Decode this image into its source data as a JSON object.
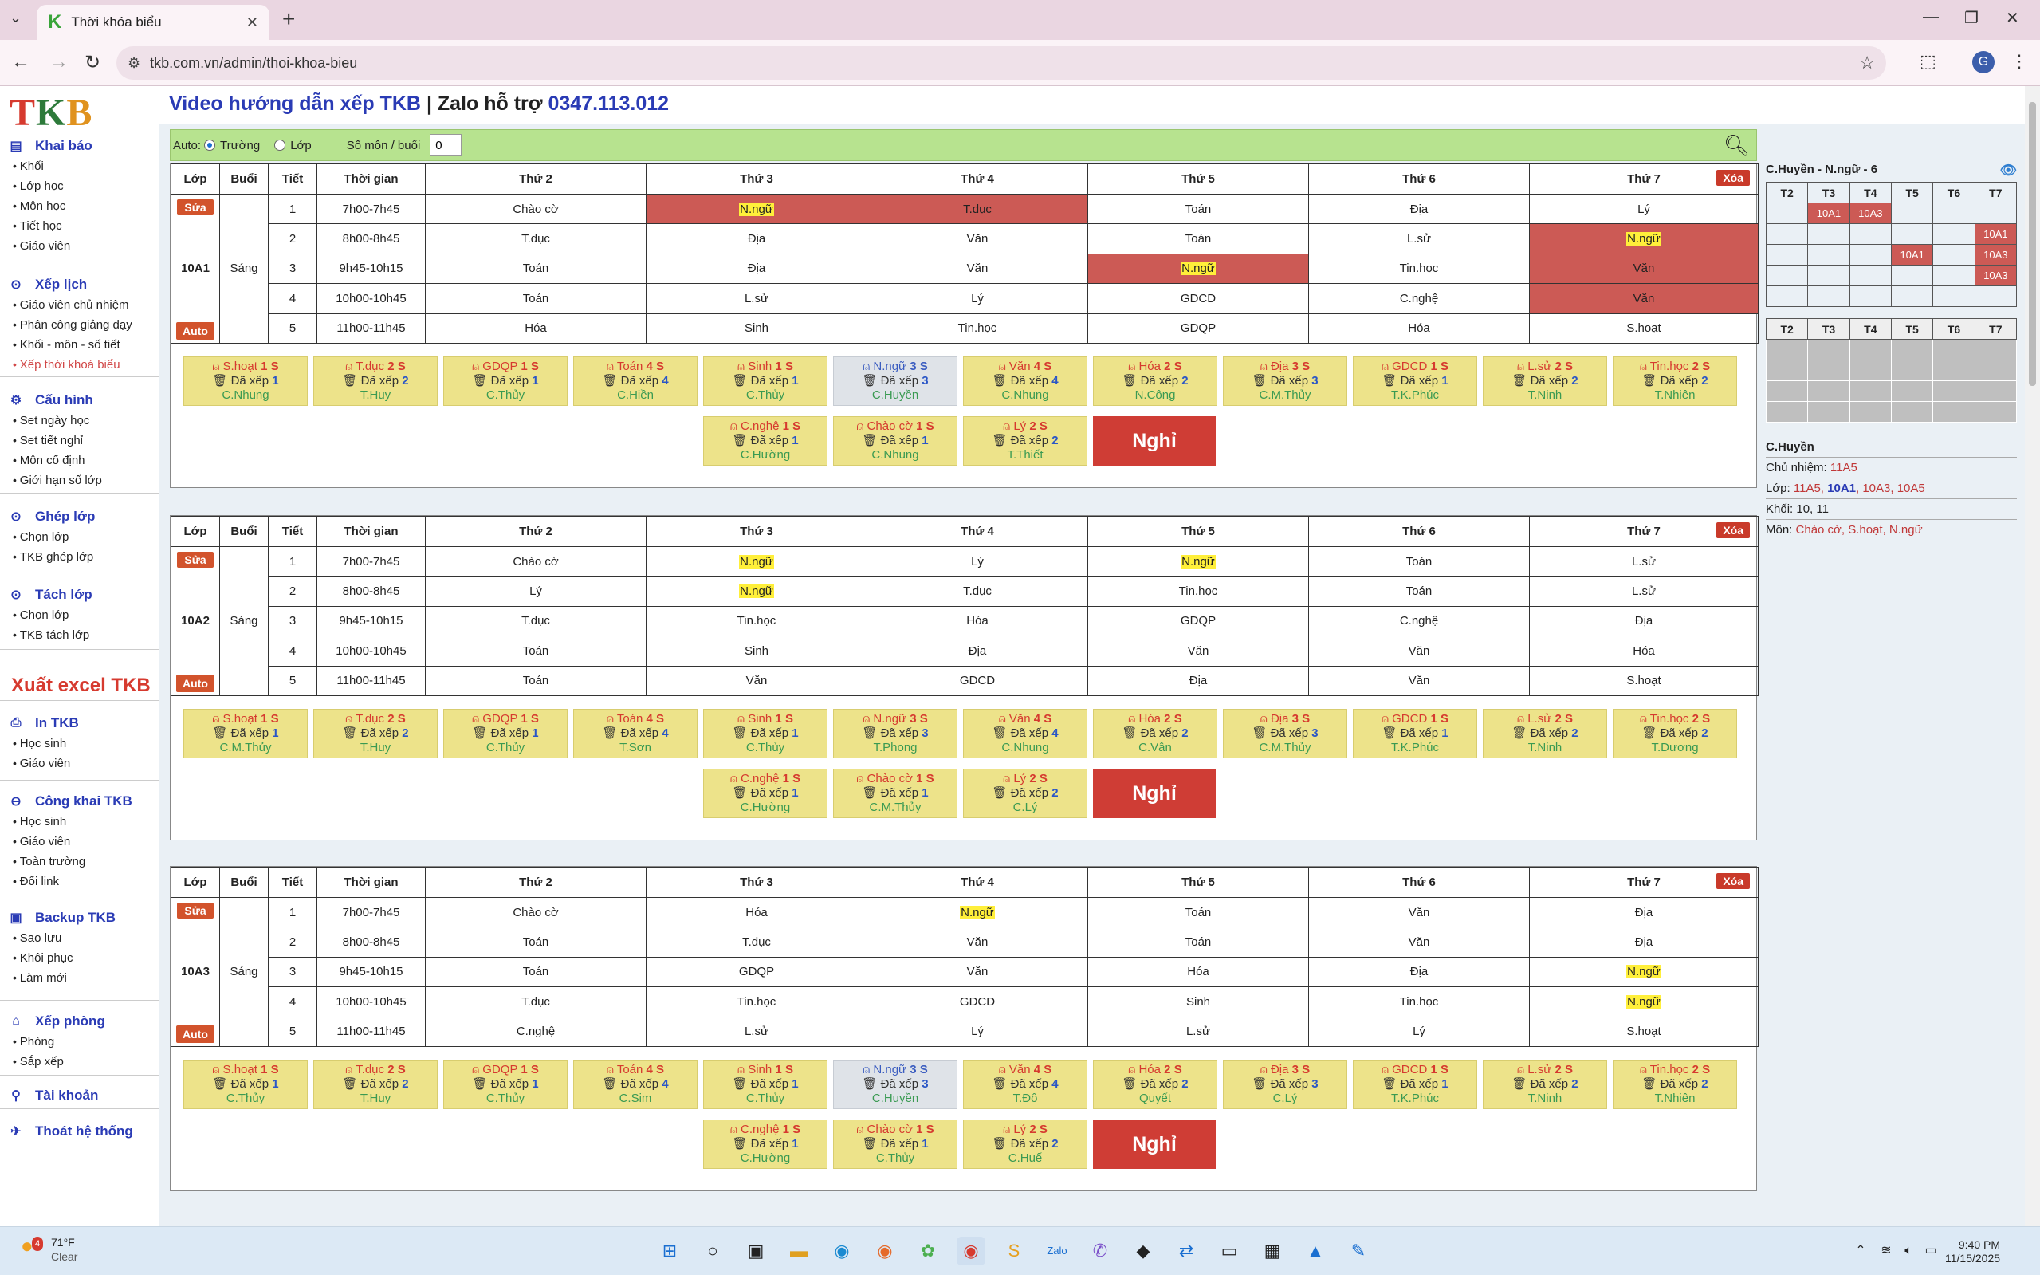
{
  "browser": {
    "tab_title": "Thời khóa biểu",
    "url": "tkb.com.vn/admin/thoi-khoa-bieu",
    "profile_initial": "G"
  },
  "sidebar": {
    "logo": {
      "part1": "T",
      "part2": "K",
      "part3": "B"
    },
    "groups": [
      {
        "title": "Khai báo",
        "icon": "folder-icon",
        "items": [
          "Khối",
          "Lớp học",
          "Môn học",
          "Tiết học",
          "Giáo viên"
        ]
      },
      {
        "title": "Xếp lịch",
        "icon": "check-circle-icon",
        "items": [
          "Giáo viên chủ nhiệm",
          "Phân công giảng dạy",
          "Khối - môn - số tiết",
          "Xếp thời khoá biểu"
        ]
      },
      {
        "title": "Cấu hình",
        "icon": "gear-icon",
        "items": [
          "Set ngày học",
          "Set tiết nghỉ",
          "Môn cố định",
          "Giới hạn số lớp"
        ]
      },
      {
        "title": "Ghép lớp",
        "icon": "check-circle-icon",
        "items": [
          "Chọn lớp",
          "TKB ghép lớp"
        ]
      },
      {
        "title": "Tách lớp",
        "icon": "check-circle-icon",
        "items": [
          "Chọn lớp",
          "TKB tách lớp"
        ]
      },
      {
        "title": "In TKB",
        "icon": "printer-icon",
        "items": [
          "Học sinh",
          "Giáo viên"
        ]
      },
      {
        "title": "Công khai TKB",
        "icon": "link-icon",
        "items": [
          "Học sinh",
          "Giáo viên",
          "Toàn trường",
          "Đổi link"
        ]
      },
      {
        "title": "Backup TKB",
        "icon": "save-icon",
        "items": [
          "Sao lưu",
          "Khôi phục",
          "Làm mới"
        ]
      },
      {
        "title": "Xếp phòng",
        "icon": "building-icon",
        "items": [
          "Phòng",
          "Sắp xếp"
        ]
      },
      {
        "title": "Tài khoản",
        "icon": "user-icon",
        "items": []
      },
      {
        "title": "Thoát hệ thống",
        "icon": "running-icon",
        "items": []
      }
    ],
    "active_item": "Xếp thời khoá biểu",
    "export_label": "Xuất excel TKB"
  },
  "header": {
    "video": "Video hướng dẫn xếp TKB",
    "sep": " | Zalo hỗ trợ ",
    "phone": "0347.113.012"
  },
  "filter": {
    "auto_label": "Auto:",
    "opt1": "Trường",
    "opt2": "Lớp",
    "count_label": "Số môn / buổi",
    "count_value": "0"
  },
  "table_headers": [
    "Lớp",
    "Buổi",
    "Tiết",
    "Thời gian",
    "Thứ 2",
    "Thứ 3",
    "Thứ 4",
    "Thứ 5",
    "Thứ 6",
    "Thứ 7"
  ],
  "buttons": {
    "edit": "Sửa",
    "auto": "Auto",
    "delete": "Xóa",
    "off": "Nghỉ"
  },
  "card_labels": {
    "arranged": "Đã xếp"
  },
  "session": "Sáng",
  "periods": [
    {
      "n": "1",
      "time": "7h00-7h45"
    },
    {
      "n": "2",
      "time": "8h00-8h45"
    },
    {
      "n": "3",
      "time": "9h45-10h15"
    },
    {
      "n": "4",
      "time": "10h00-10h45"
    },
    {
      "n": "5",
      "time": "11h00-11h45"
    }
  ],
  "classes": [
    {
      "name": "10A1",
      "rows": [
        [
          {
            "s": "Chào cờ"
          },
          {
            "s": "N.ngữ",
            "hl": true,
            "red": true
          },
          {
            "s": "T.dục",
            "red": true
          },
          {
            "s": "Toán"
          },
          {
            "s": "Địa"
          },
          {
            "s": "Lý"
          }
        ],
        [
          {
            "s": "T.dục"
          },
          {
            "s": "Địa"
          },
          {
            "s": "Văn"
          },
          {
            "s": "Toán"
          },
          {
            "s": "L.sử"
          },
          {
            "s": "N.ngữ",
            "hl": true,
            "red": true
          }
        ],
        [
          {
            "s": "Toán"
          },
          {
            "s": "Địa"
          },
          {
            "s": "Văn"
          },
          {
            "s": "N.ngữ",
            "hl": true,
            "red": true
          },
          {
            "s": "Tin.học"
          },
          {
            "s": "Văn",
            "red": true
          }
        ],
        [
          {
            "s": "Toán"
          },
          {
            "s": "L.sử"
          },
          {
            "s": "Lý"
          },
          {
            "s": "GDCD"
          },
          {
            "s": "C.nghệ"
          },
          {
            "s": "Văn",
            "red": true
          }
        ],
        [
          {
            "s": "Hóa"
          },
          {
            "s": "Sinh"
          },
          {
            "s": "Tin.học"
          },
          {
            "s": "GDQP"
          },
          {
            "s": "Hóa"
          },
          {
            "s": "S.hoạt"
          }
        ]
      ],
      "cards": [
        {
          "sub": "S.hoạt",
          "n": "1",
          "d": "1",
          "t": "C.Nhung"
        },
        {
          "sub": "T.dục",
          "n": "2",
          "d": "2",
          "t": "T.Huy"
        },
        {
          "sub": "GDQP",
          "n": "1",
          "d": "1",
          "t": "C.Thủy"
        },
        {
          "sub": "Toán",
          "n": "4",
          "d": "4",
          "t": "C.Hiền"
        },
        {
          "sub": "Sinh",
          "n": "1",
          "d": "1",
          "t": "C.Thủy"
        },
        {
          "sub": "N.ngữ",
          "n": "3",
          "d": "3",
          "t": "C.Huyền",
          "grey": true
        },
        {
          "sub": "Văn",
          "n": "4",
          "d": "4",
          "t": "C.Nhung"
        },
        {
          "sub": "Hóa",
          "n": "2",
          "d": "2",
          "t": "N.Công"
        },
        {
          "sub": "Địa",
          "n": "3",
          "d": "3",
          "t": "C.M.Thủy"
        },
        {
          "sub": "GDCD",
          "n": "1",
          "d": "1",
          "t": "T.K.Phúc"
        },
        {
          "sub": "L.sử",
          "n": "2",
          "d": "2",
          "t": "T.Ninh"
        },
        {
          "sub": "Tin.học",
          "n": "2",
          "d": "2",
          "t": "T.Nhiên"
        },
        {
          "sub": "C.nghệ",
          "n": "1",
          "d": "1",
          "t": "C.Hường"
        },
        {
          "sub": "Chào cờ",
          "n": "1",
          "d": "1",
          "t": "C.Nhung"
        },
        {
          "sub": "Lý",
          "n": "2",
          "d": "2",
          "t": "T.Thiết"
        }
      ]
    },
    {
      "name": "10A2",
      "rows": [
        [
          {
            "s": "Chào cờ"
          },
          {
            "s": "N.ngữ",
            "hl": true
          },
          {
            "s": "Lý"
          },
          {
            "s": "N.ngữ",
            "hl": true
          },
          {
            "s": "Toán"
          },
          {
            "s": "L.sử"
          }
        ],
        [
          {
            "s": "Lý"
          },
          {
            "s": "N.ngữ",
            "hl": true
          },
          {
            "s": "T.dục"
          },
          {
            "s": "Tin.học"
          },
          {
            "s": "Toán"
          },
          {
            "s": "L.sử"
          }
        ],
        [
          {
            "s": "T.dục"
          },
          {
            "s": "Tin.học"
          },
          {
            "s": "Hóa"
          },
          {
            "s": "GDQP"
          },
          {
            "s": "C.nghệ"
          },
          {
            "s": "Địa"
          }
        ],
        [
          {
            "s": "Toán"
          },
          {
            "s": "Sinh"
          },
          {
            "s": "Địa"
          },
          {
            "s": "Văn"
          },
          {
            "s": "Văn"
          },
          {
            "s": "Hóa"
          }
        ],
        [
          {
            "s": "Toán"
          },
          {
            "s": "Văn"
          },
          {
            "s": "GDCD"
          },
          {
            "s": "Địa"
          },
          {
            "s": "Văn"
          },
          {
            "s": "S.hoạt"
          }
        ]
      ],
      "cards": [
        {
          "sub": "S.hoạt",
          "n": "1",
          "d": "1",
          "t": "C.M.Thủy"
        },
        {
          "sub": "T.dục",
          "n": "2",
          "d": "2",
          "t": "T.Huy"
        },
        {
          "sub": "GDQP",
          "n": "1",
          "d": "1",
          "t": "C.Thủy"
        },
        {
          "sub": "Toán",
          "n": "4",
          "d": "4",
          "t": "T.Sơn"
        },
        {
          "sub": "Sinh",
          "n": "1",
          "d": "1",
          "t": "C.Thủy"
        },
        {
          "sub": "N.ngữ",
          "n": "3",
          "d": "3",
          "t": "T.Phong"
        },
        {
          "sub": "Văn",
          "n": "4",
          "d": "4",
          "t": "C.Nhung"
        },
        {
          "sub": "Hóa",
          "n": "2",
          "d": "2",
          "t": "C.Vân"
        },
        {
          "sub": "Địa",
          "n": "3",
          "d": "3",
          "t": "C.M.Thủy"
        },
        {
          "sub": "GDCD",
          "n": "1",
          "d": "1",
          "t": "T.K.Phúc"
        },
        {
          "sub": "L.sử",
          "n": "2",
          "d": "2",
          "t": "T.Ninh"
        },
        {
          "sub": "Tin.học",
          "n": "2",
          "d": "2",
          "t": "T.Dương"
        },
        {
          "sub": "C.nghệ",
          "n": "1",
          "d": "1",
          "t": "C.Hường"
        },
        {
          "sub": "Chào cờ",
          "n": "1",
          "d": "1",
          "t": "C.M.Thủy"
        },
        {
          "sub": "Lý",
          "n": "2",
          "d": "2",
          "t": "C.Lý"
        }
      ]
    },
    {
      "name": "10A3",
      "rows": [
        [
          {
            "s": "Chào cờ"
          },
          {
            "s": "Hóa"
          },
          {
            "s": "N.ngữ",
            "hl": true
          },
          {
            "s": "Toán"
          },
          {
            "s": "Văn"
          },
          {
            "s": "Địa"
          }
        ],
        [
          {
            "s": "Toán"
          },
          {
            "s": "T.dục"
          },
          {
            "s": "Văn"
          },
          {
            "s": "Toán"
          },
          {
            "s": "Văn"
          },
          {
            "s": "Địa"
          }
        ],
        [
          {
            "s": "Toán"
          },
          {
            "s": "GDQP"
          },
          {
            "s": "Văn"
          },
          {
            "s": "Hóa"
          },
          {
            "s": "Địa"
          },
          {
            "s": "N.ngữ",
            "hl": true
          }
        ],
        [
          {
            "s": "T.dục"
          },
          {
            "s": "Tin.học"
          },
          {
            "s": "GDCD"
          },
          {
            "s": "Sinh"
          },
          {
            "s": "Tin.học"
          },
          {
            "s": "N.ngữ",
            "hl": true
          }
        ],
        [
          {
            "s": "C.nghệ"
          },
          {
            "s": "L.sử"
          },
          {
            "s": "Lý"
          },
          {
            "s": "L.sử"
          },
          {
            "s": "Lý"
          },
          {
            "s": "S.hoạt"
          }
        ]
      ],
      "cards": [
        {
          "sub": "S.hoạt",
          "n": "1",
          "d": "1",
          "t": "C.Thủy"
        },
        {
          "sub": "T.dục",
          "n": "2",
          "d": "2",
          "t": "T.Huy"
        },
        {
          "sub": "GDQP",
          "n": "1",
          "d": "1",
          "t": "C.Thủy"
        },
        {
          "sub": "Toán",
          "n": "4",
          "d": "4",
          "t": "C.Sim"
        },
        {
          "sub": "Sinh",
          "n": "1",
          "d": "1",
          "t": "C.Thủy"
        },
        {
          "sub": "N.ngữ",
          "n": "3",
          "d": "3",
          "t": "C.Huyền",
          "grey": true
        },
        {
          "sub": "Văn",
          "n": "4",
          "d": "4",
          "t": "T.Đô"
        },
        {
          "sub": "Hóa",
          "n": "2",
          "d": "2",
          "t": "Quyết"
        },
        {
          "sub": "Địa",
          "n": "3",
          "d": "3",
          "t": "C.Lý"
        },
        {
          "sub": "GDCD",
          "n": "1",
          "d": "1",
          "t": "T.K.Phúc"
        },
        {
          "sub": "L.sử",
          "n": "2",
          "d": "2",
          "t": "T.Ninh"
        },
        {
          "sub": "Tin.học",
          "n": "2",
          "d": "2",
          "t": "T.Nhiên"
        },
        {
          "sub": "C.nghệ",
          "n": "1",
          "d": "1",
          "t": "C.Hường"
        },
        {
          "sub": "Chào cờ",
          "n": "1",
          "d": "1",
          "t": "C.Thủy"
        },
        {
          "sub": "Lý",
          "n": "2",
          "d": "2",
          "t": "C.Huế"
        }
      ]
    }
  ],
  "right_panel": {
    "title": "C.Huyền - N.ngữ - 6",
    "days": [
      "T2",
      "T3",
      "T4",
      "T5",
      "T6",
      "T7"
    ],
    "grid": [
      [
        "",
        "10A1",
        "10A3",
        "",
        "",
        ""
      ],
      [
        "",
        "",
        "",
        "",
        "",
        "10A1"
      ],
      [
        "",
        "",
        "",
        "10A1",
        "",
        "10A3"
      ],
      [
        "",
        "",
        "",
        "",
        "",
        "10A3"
      ],
      [
        "",
        "",
        "",
        "",
        "",
        ""
      ]
    ],
    "grid2_rows": 4,
    "name": "C.Huyền",
    "homeroom_label": "Chủ nhiệm:",
    "homeroom": "11A5",
    "classes_label": "Lớp:",
    "classes": [
      "11A5",
      ", ",
      "10A1",
      ", 10A3, 10A5"
    ],
    "grades_label": "Khối:",
    "grades": "10, 11",
    "subjects_label": "Môn:",
    "subjects": "Chào cờ, S.hoạt, N.ngữ"
  },
  "taskbar": {
    "temp": "71°F",
    "weather": "Clear",
    "badge": "4",
    "time": "9:40 PM",
    "date": "11/15/2025"
  }
}
